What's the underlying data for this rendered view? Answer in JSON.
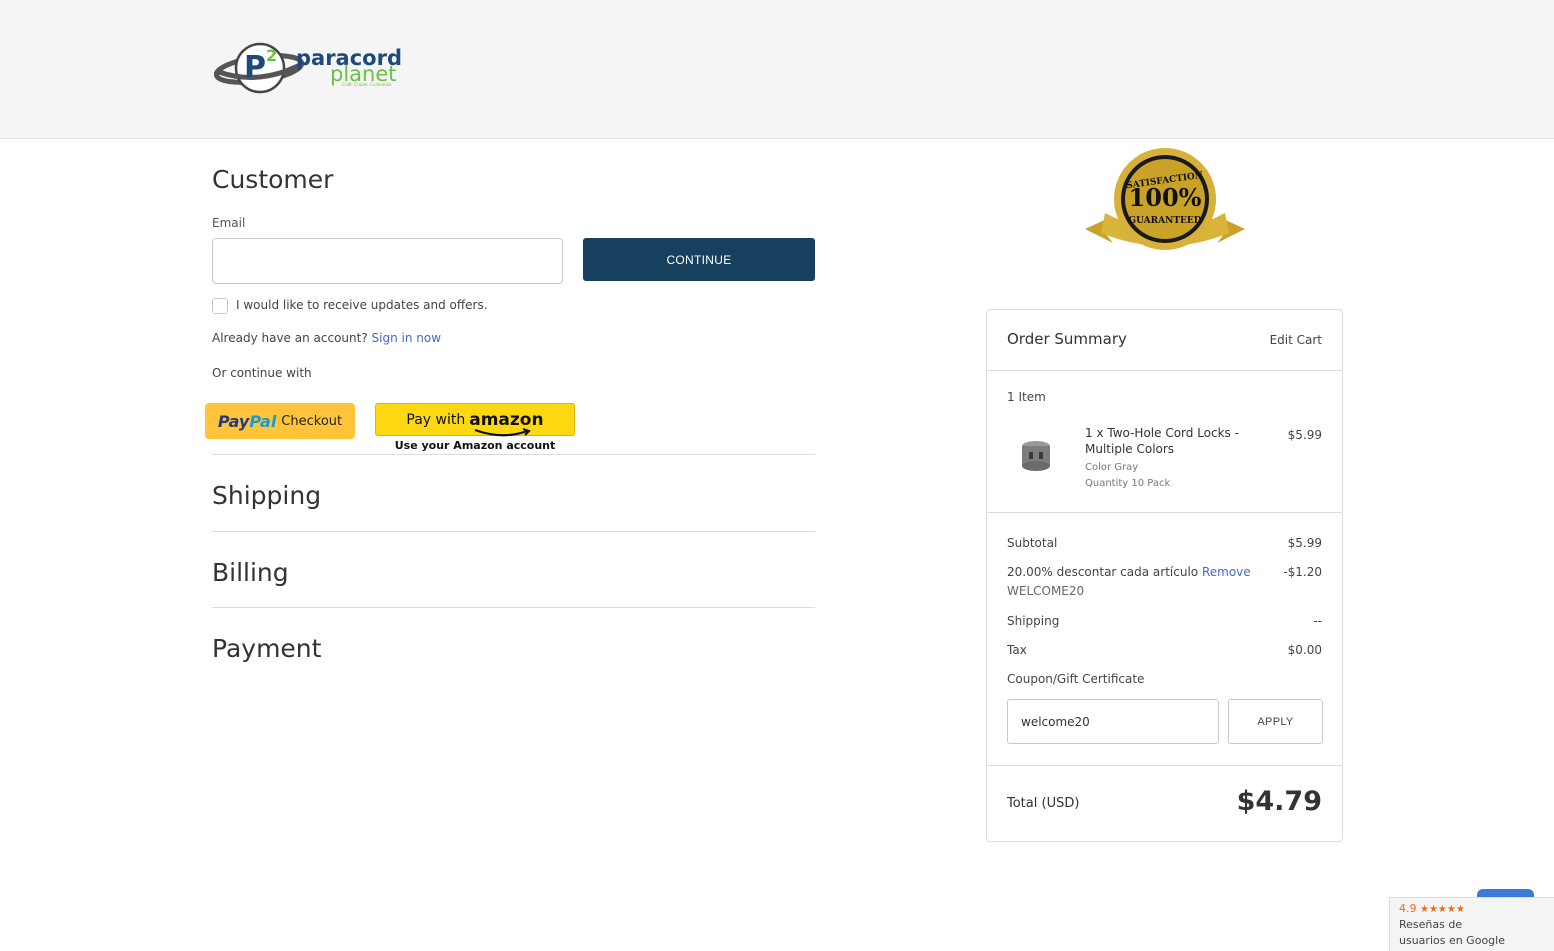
{
  "brand": {
    "line1": "paracord",
    "line2": "planet",
    "tagline": "Craft. Create. Customize.",
    "mark": "P",
    "mark_sup": "2"
  },
  "customer": {
    "heading": "Customer",
    "email_label": "Email",
    "email_value": "",
    "continue_label": "CONTINUE",
    "updates_label": "I would like to receive updates and offers.",
    "account_prompt": "Already have an account?",
    "sign_in_link": "Sign in now",
    "or_continue": "Or continue with",
    "paypal_brand_a": "Pay",
    "paypal_brand_b": "Pal",
    "paypal_checkout": "Checkout",
    "amazon_pay": "Pay with",
    "amazon_brand": "amazon",
    "amazon_sub": "Use your Amazon account"
  },
  "sections": {
    "shipping": "Shipping",
    "billing": "Billing",
    "payment": "Payment"
  },
  "badge": {
    "top": "SATISFACTION",
    "middle": "100%",
    "bottom": "GUARANTEED"
  },
  "summary": {
    "title": "Order Summary",
    "edit_cart": "Edit Cart",
    "item_count": "1 Item",
    "item": {
      "name_line1": "1 x Two-Hole Cord Locks -",
      "name_line2": "Multiple Colors",
      "option1": "Color Gray",
      "option2": "Quantity 10 Pack",
      "price": "$5.99"
    },
    "subtotal_label": "Subtotal",
    "subtotal_value": "$5.99",
    "discount_label": "20.00% descontar cada artículo",
    "discount_remove": "Remove",
    "discount_code": "WELCOME20",
    "discount_value": "-$1.20",
    "shipping_label": "Shipping",
    "shipping_value": "--",
    "tax_label": "Tax",
    "tax_value": "$0.00",
    "coupon_link": "Coupon/Gift Certificate",
    "coupon_value": "welcome20",
    "apply_label": "APPLY",
    "total_label": "Total (USD)",
    "total_value": "$4.79"
  },
  "google_reviews": {
    "rating": "4.9",
    "stars": "★★★★★",
    "line1": "Reseñas de",
    "line2": "usuarios en Google"
  },
  "colors": {
    "primary": "#17405f",
    "link": "#4568c9",
    "paypal": "#ffc439",
    "amazon": "#fdd811",
    "logo_blue": "#1d4a7a",
    "logo_green": "#6cbe45"
  }
}
